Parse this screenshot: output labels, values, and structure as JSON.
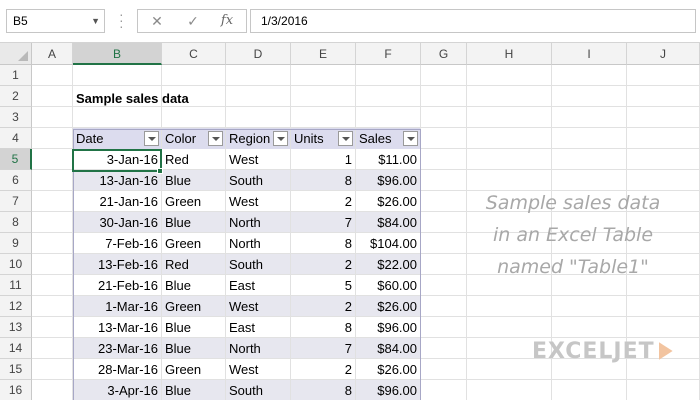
{
  "formula_bar": {
    "name_box": "B5",
    "cancel_icon": "✕",
    "enter_icon": "✓",
    "fx_label": "fx",
    "formula": "1/3/2016"
  },
  "columns": [
    "A",
    "B",
    "C",
    "D",
    "E",
    "F",
    "G",
    "H",
    "I",
    "J"
  ],
  "rows": [
    "1",
    "2",
    "3",
    "4",
    "5",
    "6",
    "7",
    "8",
    "9",
    "10",
    "11",
    "12",
    "13",
    "14",
    "15",
    "16"
  ],
  "selection": {
    "column": "B",
    "row": "5"
  },
  "sheet_title": "Sample sales data",
  "table": {
    "headers": [
      "Date",
      "Color",
      "Region",
      "Units",
      "Sales"
    ],
    "rows": [
      [
        "3-Jan-16",
        "Red",
        "West",
        "1",
        "$11.00"
      ],
      [
        "13-Jan-16",
        "Blue",
        "South",
        "8",
        "$96.00"
      ],
      [
        "21-Jan-16",
        "Green",
        "West",
        "2",
        "$26.00"
      ],
      [
        "30-Jan-16",
        "Blue",
        "North",
        "7",
        "$84.00"
      ],
      [
        "7-Feb-16",
        "Green",
        "North",
        "8",
        "$104.00"
      ],
      [
        "13-Feb-16",
        "Red",
        "South",
        "2",
        "$22.00"
      ],
      [
        "21-Feb-16",
        "Blue",
        "East",
        "5",
        "$60.00"
      ],
      [
        "1-Mar-16",
        "Green",
        "West",
        "2",
        "$26.00"
      ],
      [
        "13-Mar-16",
        "Blue",
        "East",
        "8",
        "$96.00"
      ],
      [
        "23-Mar-16",
        "Blue",
        "North",
        "7",
        "$84.00"
      ],
      [
        "28-Mar-16",
        "Green",
        "West",
        "2",
        "$26.00"
      ],
      [
        "3-Apr-16",
        "Blue",
        "South",
        "8",
        "$96.00"
      ]
    ]
  },
  "note_lines": [
    "Sample sales data",
    "in an Excel Table",
    "named \"Table1\""
  ],
  "logo_text": "EXCELJET",
  "colors": {
    "excel_green": "#217346",
    "table_band": "#e7e7ef",
    "table_header": "#dcdcee"
  }
}
